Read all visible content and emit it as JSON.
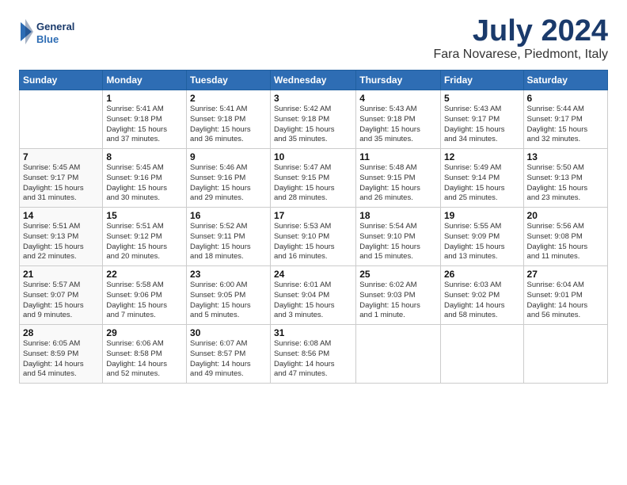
{
  "logo": {
    "line1": "General",
    "line2": "Blue"
  },
  "title": "July 2024",
  "subtitle": "Fara Novarese, Piedmont, Italy",
  "headers": [
    "Sunday",
    "Monday",
    "Tuesday",
    "Wednesday",
    "Thursday",
    "Friday",
    "Saturday"
  ],
  "weeks": [
    [
      {
        "num": "",
        "lines": []
      },
      {
        "num": "1",
        "lines": [
          "Sunrise: 5:41 AM",
          "Sunset: 9:18 PM",
          "Daylight: 15 hours",
          "and 37 minutes."
        ]
      },
      {
        "num": "2",
        "lines": [
          "Sunrise: 5:41 AM",
          "Sunset: 9:18 PM",
          "Daylight: 15 hours",
          "and 36 minutes."
        ]
      },
      {
        "num": "3",
        "lines": [
          "Sunrise: 5:42 AM",
          "Sunset: 9:18 PM",
          "Daylight: 15 hours",
          "and 35 minutes."
        ]
      },
      {
        "num": "4",
        "lines": [
          "Sunrise: 5:43 AM",
          "Sunset: 9:18 PM",
          "Daylight: 15 hours",
          "and 35 minutes."
        ]
      },
      {
        "num": "5",
        "lines": [
          "Sunrise: 5:43 AM",
          "Sunset: 9:17 PM",
          "Daylight: 15 hours",
          "and 34 minutes."
        ]
      },
      {
        "num": "6",
        "lines": [
          "Sunrise: 5:44 AM",
          "Sunset: 9:17 PM",
          "Daylight: 15 hours",
          "and 32 minutes."
        ]
      }
    ],
    [
      {
        "num": "7",
        "lines": [
          "Sunrise: 5:45 AM",
          "Sunset: 9:17 PM",
          "Daylight: 15 hours",
          "and 31 minutes."
        ]
      },
      {
        "num": "8",
        "lines": [
          "Sunrise: 5:45 AM",
          "Sunset: 9:16 PM",
          "Daylight: 15 hours",
          "and 30 minutes."
        ]
      },
      {
        "num": "9",
        "lines": [
          "Sunrise: 5:46 AM",
          "Sunset: 9:16 PM",
          "Daylight: 15 hours",
          "and 29 minutes."
        ]
      },
      {
        "num": "10",
        "lines": [
          "Sunrise: 5:47 AM",
          "Sunset: 9:15 PM",
          "Daylight: 15 hours",
          "and 28 minutes."
        ]
      },
      {
        "num": "11",
        "lines": [
          "Sunrise: 5:48 AM",
          "Sunset: 9:15 PM",
          "Daylight: 15 hours",
          "and 26 minutes."
        ]
      },
      {
        "num": "12",
        "lines": [
          "Sunrise: 5:49 AM",
          "Sunset: 9:14 PM",
          "Daylight: 15 hours",
          "and 25 minutes."
        ]
      },
      {
        "num": "13",
        "lines": [
          "Sunrise: 5:50 AM",
          "Sunset: 9:13 PM",
          "Daylight: 15 hours",
          "and 23 minutes."
        ]
      }
    ],
    [
      {
        "num": "14",
        "lines": [
          "Sunrise: 5:51 AM",
          "Sunset: 9:13 PM",
          "Daylight: 15 hours",
          "and 22 minutes."
        ]
      },
      {
        "num": "15",
        "lines": [
          "Sunrise: 5:51 AM",
          "Sunset: 9:12 PM",
          "Daylight: 15 hours",
          "and 20 minutes."
        ]
      },
      {
        "num": "16",
        "lines": [
          "Sunrise: 5:52 AM",
          "Sunset: 9:11 PM",
          "Daylight: 15 hours",
          "and 18 minutes."
        ]
      },
      {
        "num": "17",
        "lines": [
          "Sunrise: 5:53 AM",
          "Sunset: 9:10 PM",
          "Daylight: 15 hours",
          "and 16 minutes."
        ]
      },
      {
        "num": "18",
        "lines": [
          "Sunrise: 5:54 AM",
          "Sunset: 9:10 PM",
          "Daylight: 15 hours",
          "and 15 minutes."
        ]
      },
      {
        "num": "19",
        "lines": [
          "Sunrise: 5:55 AM",
          "Sunset: 9:09 PM",
          "Daylight: 15 hours",
          "and 13 minutes."
        ]
      },
      {
        "num": "20",
        "lines": [
          "Sunrise: 5:56 AM",
          "Sunset: 9:08 PM",
          "Daylight: 15 hours",
          "and 11 minutes."
        ]
      }
    ],
    [
      {
        "num": "21",
        "lines": [
          "Sunrise: 5:57 AM",
          "Sunset: 9:07 PM",
          "Daylight: 15 hours",
          "and 9 minutes."
        ]
      },
      {
        "num": "22",
        "lines": [
          "Sunrise: 5:58 AM",
          "Sunset: 9:06 PM",
          "Daylight: 15 hours",
          "and 7 minutes."
        ]
      },
      {
        "num": "23",
        "lines": [
          "Sunrise: 6:00 AM",
          "Sunset: 9:05 PM",
          "Daylight: 15 hours",
          "and 5 minutes."
        ]
      },
      {
        "num": "24",
        "lines": [
          "Sunrise: 6:01 AM",
          "Sunset: 9:04 PM",
          "Daylight: 15 hours",
          "and 3 minutes."
        ]
      },
      {
        "num": "25",
        "lines": [
          "Sunrise: 6:02 AM",
          "Sunset: 9:03 PM",
          "Daylight: 15 hours",
          "and 1 minute."
        ]
      },
      {
        "num": "26",
        "lines": [
          "Sunrise: 6:03 AM",
          "Sunset: 9:02 PM",
          "Daylight: 14 hours",
          "and 58 minutes."
        ]
      },
      {
        "num": "27",
        "lines": [
          "Sunrise: 6:04 AM",
          "Sunset: 9:01 PM",
          "Daylight: 14 hours",
          "and 56 minutes."
        ]
      }
    ],
    [
      {
        "num": "28",
        "lines": [
          "Sunrise: 6:05 AM",
          "Sunset: 8:59 PM",
          "Daylight: 14 hours",
          "and 54 minutes."
        ]
      },
      {
        "num": "29",
        "lines": [
          "Sunrise: 6:06 AM",
          "Sunset: 8:58 PM",
          "Daylight: 14 hours",
          "and 52 minutes."
        ]
      },
      {
        "num": "30",
        "lines": [
          "Sunrise: 6:07 AM",
          "Sunset: 8:57 PM",
          "Daylight: 14 hours",
          "and 49 minutes."
        ]
      },
      {
        "num": "31",
        "lines": [
          "Sunrise: 6:08 AM",
          "Sunset: 8:56 PM",
          "Daylight: 14 hours",
          "and 47 minutes."
        ]
      },
      {
        "num": "",
        "lines": []
      },
      {
        "num": "",
        "lines": []
      },
      {
        "num": "",
        "lines": []
      }
    ]
  ]
}
